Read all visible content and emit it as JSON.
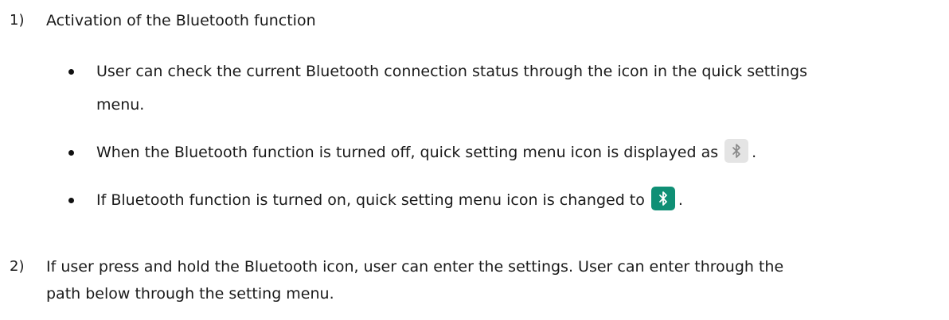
{
  "section1": {
    "number": "1)",
    "title": "Activation of the Bluetooth function",
    "bullets": [
      {
        "line1": "User can check the current Bluetooth connection status through the icon in the quick settings",
        "line2": "menu."
      },
      {
        "text": "When the Bluetooth function is turned off, quick setting menu icon is displayed as",
        "icon": "bluetooth-off-icon",
        "tail": "."
      },
      {
        "text": "If Bluetooth function is turned on, quick setting menu icon is changed to",
        "icon": "bluetooth-on-icon",
        "tail": "."
      }
    ]
  },
  "section2": {
    "number": "2)",
    "line1": "If user press and hold the Bluetooth icon, user can enter the settings. User can enter through the",
    "line2": "path below through the setting menu."
  },
  "colors": {
    "icon_off_bg": "#e4e4e4",
    "icon_on_bg": "#0f8f75"
  }
}
